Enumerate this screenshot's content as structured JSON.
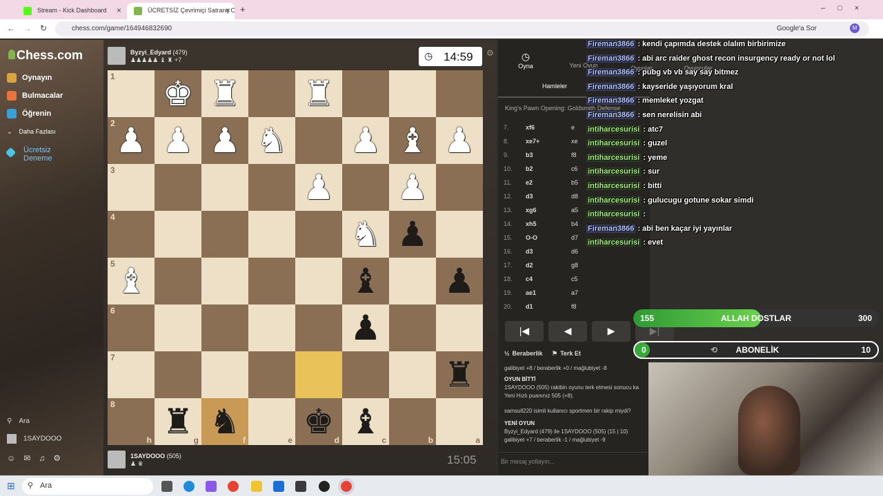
{
  "browser": {
    "tabs": [
      {
        "label": "Stream - Kick Dashboard"
      },
      {
        "label": "ÜCRETSİZ Çevrimiçi Satranç Oy"
      }
    ],
    "url": "chess.com/game/164946832690",
    "google": "Google'a Sor",
    "profile": "M"
  },
  "sidebar": {
    "logo": "Chess.com",
    "items": [
      {
        "label": "Oynayın"
      },
      {
        "label": "Bulmacalar"
      },
      {
        "label": "Öğrenin"
      },
      {
        "label": "Daha Fazlası"
      },
      {
        "label": "Ücretsiz Deneme"
      }
    ],
    "search": "Ara",
    "user": "1SAYDOOO"
  },
  "top_player": {
    "name": "Byzyi_Edyard",
    "rating": "(479)",
    "extra": "+7",
    "clock": "14:59"
  },
  "bottom_player": {
    "name": "1SAYDOOO",
    "rating": "(505)",
    "clock": "15:05"
  },
  "board": {
    "ranks": [
      "1",
      "2",
      "3",
      "4",
      "5",
      "6",
      "7",
      "8"
    ],
    "files": [
      "h",
      "g",
      "f",
      "e",
      "d",
      "c",
      "b",
      "a"
    ],
    "rows": [
      [
        "",
        "♚",
        "♜",
        "",
        "♜",
        "",
        "",
        ""
      ],
      [
        "♟",
        "♟",
        "♟",
        "♞",
        "",
        "♟",
        "♝",
        "♟"
      ],
      [
        "",
        "",
        "",
        "",
        "♟",
        "",
        "♟",
        ""
      ],
      [
        "",
        "",
        "",
        "",
        "",
        "♞",
        "♟",
        ""
      ],
      [
        "♝",
        "",
        "",
        "",
        "",
        "♝",
        "",
        "♟"
      ],
      [
        "",
        "",
        "",
        "",
        "",
        "♟",
        "",
        ""
      ],
      [
        "",
        "",
        "",
        "",
        "",
        "",
        "",
        "♜"
      ],
      [
        "",
        "♜",
        "♞",
        "",
        "♚",
        "♝",
        "",
        ""
      ]
    ],
    "colors": [
      [
        "",
        "w",
        "w",
        "",
        "w",
        "",
        "",
        ""
      ],
      [
        "w",
        "w",
        "w",
        "w",
        "",
        "w",
        "w",
        "w"
      ],
      [
        "",
        "",
        "",
        "",
        "w",
        "",
        "w",
        ""
      ],
      [
        "",
        "",
        "",
        "",
        "",
        "w",
        "b",
        ""
      ],
      [
        "w",
        "",
        "",
        "",
        "",
        "b",
        "",
        "b"
      ],
      [
        "",
        "",
        "",
        "",
        "",
        "b",
        "",
        ""
      ],
      [
        "",
        "",
        "",
        "",
        "",
        "",
        "",
        "b"
      ],
      [
        "",
        "b",
        "b",
        "",
        "b",
        "b",
        "",
        ""
      ]
    ]
  },
  "panel": {
    "tabs": [
      {
        "label": "Oyna"
      },
      {
        "label": "Yeni Oyun"
      },
      {
        "label": "Oyunlar"
      },
      {
        "label": "Oyuncular"
      }
    ],
    "moves_tab": "Hamleler",
    "opening": "King's Pawn Opening: Goldsmith Defense",
    "moves": [
      {
        "n": "7.",
        "w": "xf6",
        "b": "e"
      },
      {
        "n": "8.",
        "w": "xe7+",
        "b": "xe"
      },
      {
        "n": "9.",
        "w": "b3",
        "b": "f8"
      },
      {
        "n": "10.",
        "w": "b2",
        "b": "c6"
      },
      {
        "n": "11.",
        "w": "e2",
        "b": "b5"
      },
      {
        "n": "12.",
        "w": "d3",
        "b": "d8"
      },
      {
        "n": "13.",
        "w": "xg6",
        "b": "a5"
      },
      {
        "n": "14.",
        "w": "xh5",
        "b": "b4"
      },
      {
        "n": "15.",
        "w": "O-O",
        "b": "d7"
      },
      {
        "n": "16.",
        "w": "d3",
        "b": "d6"
      },
      {
        "n": "17.",
        "w": "d2",
        "b": "g8"
      },
      {
        "n": "18.",
        "w": "c4",
        "b": "c5"
      },
      {
        "n": "19.",
        "w": "ae1",
        "b": "a7"
      },
      {
        "n": "20.",
        "w": "d1",
        "b": "f8"
      }
    ],
    "draw": "Beraberlik",
    "resign": "Terk Et",
    "log": [
      {
        "t": "galibiyet +8 / beraberlik +0 / mağlubiyet -8",
        "b": false
      },
      {
        "t": "OYUN BİTTİ",
        "b": true
      },
      {
        "t": "1SAYDOOO (505) rakibin oyunu terk etmesi sonucu ka",
        "b": false
      },
      {
        "t": "Yeni Hızlı puanınız 505 (+8).",
        "b": false
      },
      {
        "t": "samsull220 isimli kullanıcı sportmen bir rakip miydi?",
        "b": false
      },
      {
        "t": "YENİ OYUN",
        "b": true
      },
      {
        "t": "Byzyi_Edyard (479) ile 1SAYDOOO (505) (15 | 10)",
        "b": false
      },
      {
        "t": "galibiyet +7 / beraberlik -1 / mağlubiyet -9",
        "b": false
      }
    ],
    "message_placeholder": "Bir mesaj yollayın..."
  },
  "chat": [
    {
      "u": "Fireman3866",
      "m": "kendi çapımda destek olalım birbirimize",
      "c": "u1"
    },
    {
      "u": "Fireman3866",
      "m": "abi arc raider ghost recon insurgency ready or not lol",
      "c": "u1"
    },
    {
      "u": "Fireman3866",
      "m": "pubg vb vb say say bitmez",
      "c": "u1"
    },
    {
      "u": "Fireman3866",
      "m": "kayseride yaşıyorum kral",
      "c": "u1"
    },
    {
      "u": "Fireman3866",
      "m": "memleket yozgat",
      "c": "u1"
    },
    {
      "u": "Fireman3866",
      "m": "sen nerelisin abi",
      "c": "u1"
    },
    {
      "u": "intiharcesurisi",
      "m": "atc7",
      "c": "u2"
    },
    {
      "u": "intiharcesurisi",
      "m": "guzel",
      "c": "u2"
    },
    {
      "u": "intiharcesurisi",
      "m": "yeme",
      "c": "u2"
    },
    {
      "u": "intiharcesurisi",
      "m": "sur",
      "c": "u2"
    },
    {
      "u": "intiharcesurisi",
      "m": "bitti",
      "c": "u2"
    },
    {
      "u": "intiharcesurisi",
      "m": "gulucugu gotune sokar simdi",
      "c": "u2"
    },
    {
      "u": "intiharcesurisi",
      "m": "",
      "c": "u2"
    },
    {
      "u": "Fireman3866",
      "m": "abi ben kaçar iyi yayınlar",
      "c": "u1"
    },
    {
      "u": "intiharcesurisi",
      "m": "evet",
      "c": "u2"
    }
  ],
  "goals": [
    {
      "start": "155",
      "label": "ALLAH DOSTLAR",
      "end": "300",
      "progress": 0.52
    },
    {
      "start": "0",
      "label": "ABONELİK",
      "end": "10",
      "progress": 0.0
    }
  ],
  "taskbar": {
    "search": "Ara"
  }
}
